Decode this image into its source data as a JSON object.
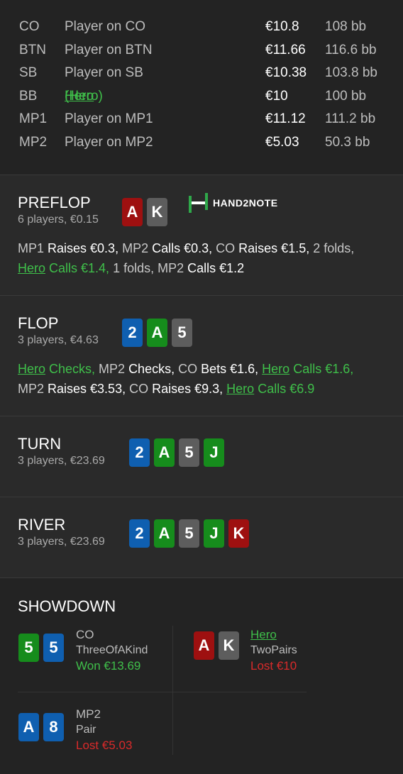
{
  "players": [
    {
      "pos": "CO",
      "name": "Player on CO",
      "stack": "€10.8",
      "bb": "108 bb"
    },
    {
      "pos": "BTN",
      "name": "Player on BTN",
      "stack": "€11.66",
      "bb": "116.6 bb"
    },
    {
      "pos": "SB",
      "name": "Player on SB",
      "stack": "€10.38",
      "bb": "103.8 bb"
    },
    {
      "pos": "BB",
      "name": "Hero",
      "name_suffix": " (Hero)",
      "stack": "€10",
      "bb": "100 bb"
    },
    {
      "pos": "MP1",
      "name": "Player on MP1",
      "stack": "€11.12",
      "bb": "111.2 bb"
    },
    {
      "pos": "MP2",
      "name": "Player on MP2",
      "stack": "€5.03",
      "bb": "50.3 bb"
    }
  ],
  "logo_text": "HAND2NOTE",
  "preflop": {
    "title": "PREFLOP",
    "sub": "6 players, €0.15",
    "cards": [
      "A",
      "K"
    ],
    "actions": [
      {
        "t": "MP1 ",
        "c": "n"
      },
      {
        "t": "Raises €0.3, ",
        "c": "w"
      },
      {
        "t": "MP2 ",
        "c": "n"
      },
      {
        "t": "Calls €0.3, ",
        "c": "w"
      },
      {
        "t": "CO ",
        "c": "n"
      },
      {
        "t": "Raises €1.5, ",
        "c": "w"
      },
      {
        "t": "2 folds, ",
        "c": "n"
      },
      {
        "t": "Hero",
        "c": "gu"
      },
      {
        "t": " Calls €1.4, ",
        "c": "g"
      },
      {
        "t": "1 folds, ",
        "c": "n"
      },
      {
        "t": "MP2 ",
        "c": "n"
      },
      {
        "t": "Calls €1.2",
        "c": "w"
      }
    ]
  },
  "flop": {
    "title": "FLOP",
    "sub": "3 players, €4.63",
    "cards": [
      "2",
      "A",
      "5"
    ],
    "actions": [
      {
        "t": "Hero",
        "c": "gu"
      },
      {
        "t": " Checks, ",
        "c": "g"
      },
      {
        "t": "MP2 ",
        "c": "n"
      },
      {
        "t": "Checks, ",
        "c": "w"
      },
      {
        "t": "CO ",
        "c": "n"
      },
      {
        "t": "Bets €1.6, ",
        "c": "w"
      },
      {
        "t": "Hero",
        "c": "gu"
      },
      {
        "t": " Calls €1.6, ",
        "c": "g"
      },
      {
        "t": "MP2 ",
        "c": "n"
      },
      {
        "t": "Raises €3.53, ",
        "c": "w"
      },
      {
        "t": "CO ",
        "c": "n"
      },
      {
        "t": "Raises €9.3, ",
        "c": "w"
      },
      {
        "t": "Hero",
        "c": "gu"
      },
      {
        "t": " Calls €6.9",
        "c": "g"
      }
    ]
  },
  "turn": {
    "title": "TURN",
    "sub": "3 players, €23.69",
    "cards": [
      "2",
      "A",
      "5",
      "J"
    ]
  },
  "river": {
    "title": "RIVER",
    "sub": "3 players, €23.69",
    "cards": [
      "2",
      "A",
      "5",
      "J",
      "K"
    ]
  },
  "showdown": {
    "title": "SHOWDOWN",
    "entries": [
      {
        "name": "CO",
        "hand": "ThreeOfAKind",
        "result": "Won €13.69",
        "outcome": "won",
        "cards": [
          "5",
          "5"
        ]
      },
      {
        "name": "Hero",
        "hand": "TwoPairs",
        "result": "Lost €10",
        "outcome": "lost",
        "cards": [
          "A",
          "K"
        ]
      },
      {
        "name": "MP2",
        "hand": "Pair",
        "result": "Lost €5.03",
        "outcome": "lost",
        "cards": [
          "A",
          "8"
        ]
      }
    ]
  },
  "colors": {
    "hero": "#3fbf4a",
    "lost": "#d92a2a",
    "spade": "#5d5d5d",
    "heart": "#9e1010",
    "diamond": "#0f5fb0",
    "club": "#168c1c"
  }
}
